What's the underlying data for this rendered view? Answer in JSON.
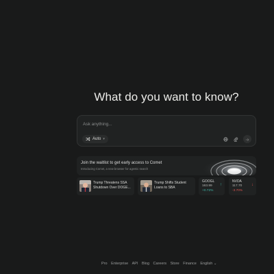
{
  "main": {
    "headline": "What do you want to know?"
  },
  "search": {
    "placeholder": "Ask anything...",
    "mode_label": "Auto",
    "mode_icon": "shuffle-icon",
    "icons": [
      "globe-icon",
      "paperclip-icon",
      "arrow-right-icon"
    ]
  },
  "banner": {
    "title": "Join the waitlist to get early access to Comet",
    "subtitle": "Introducing Comet, a new browser for agentic search"
  },
  "news": [
    {
      "title_line1": "Trump Threatens SSA",
      "title_line2": "Shutdown Over DOGE..."
    },
    {
      "title_line1": "Trump Shifts Student",
      "title_line2": "Loans to SBA"
    }
  ],
  "stocks": [
    {
      "ticker": "GOOGL",
      "price": "163.99",
      "change": "+0.72%",
      "color": "#3fb8a8"
    },
    {
      "ticker": "NVDA",
      "price": "117.70",
      "change": "-3.70%",
      "color": "#d9534f"
    }
  ],
  "footer": {
    "links": [
      "Pro",
      "Enterprise",
      "API",
      "Blog",
      "Careers",
      "Store",
      "Finance",
      "English"
    ]
  },
  "colors": {
    "background": "#191a1a",
    "accent_teal": "#3fb8a8",
    "negative_red": "#d9534f"
  }
}
